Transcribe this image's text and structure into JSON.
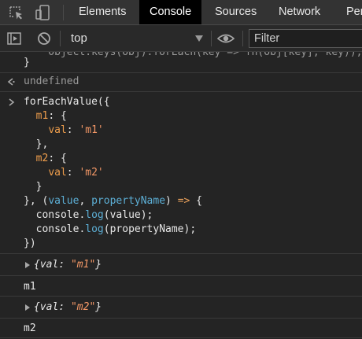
{
  "toolbar": {
    "inspect_icon": "element-picker-icon",
    "device_icon": "device-toolbar-icon"
  },
  "tabs": [
    {
      "label": "Elements",
      "active": false
    },
    {
      "label": "Console",
      "active": true
    },
    {
      "label": "Sources",
      "active": false
    },
    {
      "label": "Network",
      "active": false
    },
    {
      "label": "Per",
      "active": false
    }
  ],
  "filterbar": {
    "sidebar_icon": "sidebar-toggle-icon",
    "clear_icon": "clear-console-icon",
    "context": "top",
    "eye_icon": "eye-icon",
    "filter_placeholder": "Filter"
  },
  "console": {
    "clipped_line": "    Object.keys(obj).forEach(key => fn(obj[key], key));",
    "close_brace": "}",
    "result_undefined": "undefined",
    "code": {
      "l1_fn": "forEachValue",
      "l1_rest": "({",
      "l2_key": "m1",
      "l2_rest": ": {",
      "l3_key": "val",
      "l3_sep": ": ",
      "l3_val": "'m1'",
      "l4": "},",
      "l5_key": "m2",
      "l5_rest": ": {",
      "l6_key": "val",
      "l6_sep": ": ",
      "l6_val": "'m2'",
      "l7": "}",
      "l8_a": "}, (",
      "l8_p1": "value",
      "l8_b": ", ",
      "l8_p2": "propertyName",
      "l8_c": ") ",
      "l8_arrow": "=>",
      "l8_d": " {",
      "l9_a": "console.",
      "l9_m": "log",
      "l9_b": "(value);",
      "l10_a": "console.",
      "l10_m": "log",
      "l10_b": "(propertyName);",
      "l11": "})"
    },
    "outputs": [
      {
        "type": "object",
        "open": "{",
        "key": "val",
        "sep": ": ",
        "value": "\"m1\"",
        "close": "}"
      },
      {
        "type": "text",
        "text": "m1"
      },
      {
        "type": "object",
        "open": "{",
        "key": "val",
        "sep": ": ",
        "value": "\"m2\"",
        "close": "}"
      },
      {
        "type": "text",
        "text": "m2"
      }
    ]
  },
  "colors": {
    "background": "#242424",
    "tabbar": "#333333",
    "active_tab": "#000000",
    "string": "#f29766",
    "property": "#ef9e4c",
    "parameter": "#5db0d7"
  }
}
